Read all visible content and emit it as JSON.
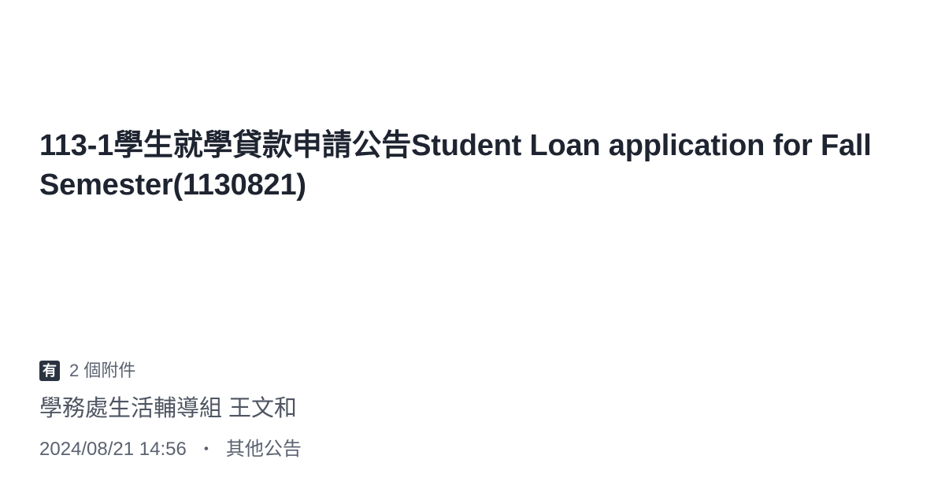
{
  "post": {
    "title": "113-1學生就學貸款申請公告Student Loan application for Fall Semester(1130821)",
    "attachment_icon_glyph": "有",
    "attachments_text": "2 個附件",
    "author": "學務處生活輔導組 王文和",
    "date": "2024/08/21 14:56",
    "separator": "・",
    "category": "其他公告"
  },
  "icons": {
    "attachment": "attachment-badge-icon"
  },
  "colors": {
    "background": "#ffffff",
    "title": "#1e2430",
    "secondary_text": "#5b6270",
    "badge_bg": "#2b3340"
  }
}
